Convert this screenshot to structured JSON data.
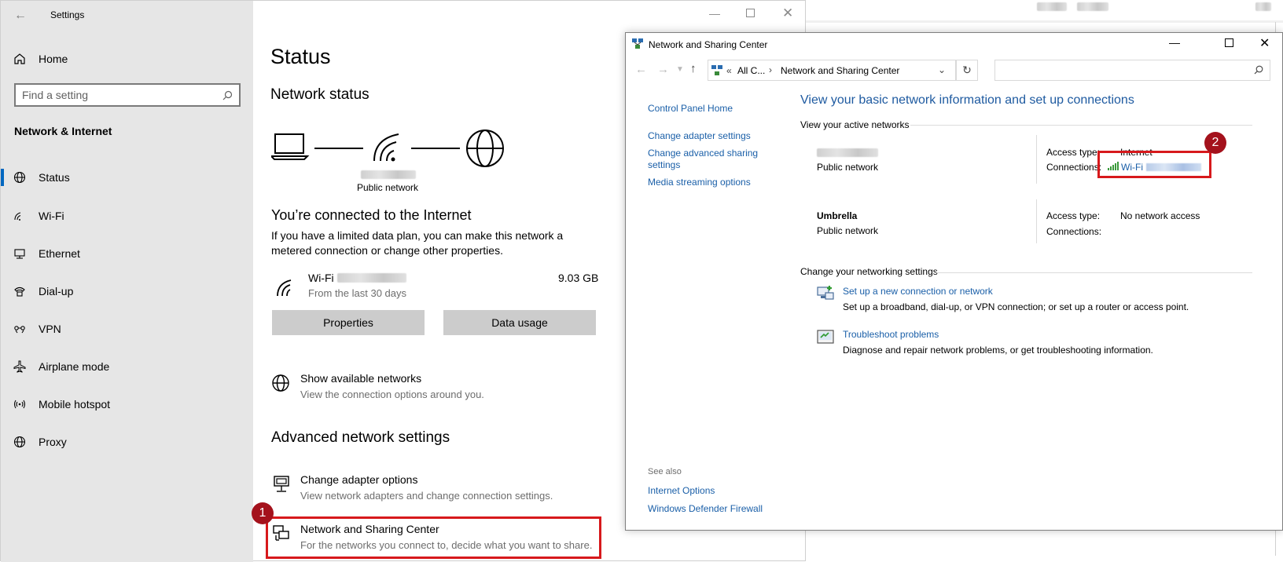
{
  "settings": {
    "window_title": "Settings",
    "sidebar": {
      "home_label": "Home",
      "search_placeholder": "Find a setting",
      "category": "Network & Internet",
      "items": [
        {
          "label": "Status",
          "icon": "globe-status-icon"
        },
        {
          "label": "Wi-Fi",
          "icon": "wifi-icon"
        },
        {
          "label": "Ethernet",
          "icon": "ethernet-icon"
        },
        {
          "label": "Dial-up",
          "icon": "dialup-icon"
        },
        {
          "label": "VPN",
          "icon": "vpn-icon"
        },
        {
          "label": "Airplane mode",
          "icon": "airplane-icon"
        },
        {
          "label": "Mobile hotspot",
          "icon": "hotspot-icon"
        },
        {
          "label": "Proxy",
          "icon": "proxy-icon"
        }
      ]
    },
    "main": {
      "page_title": "Status",
      "network_status_heading": "Network status",
      "diagram_label": "Public network",
      "connected_heading": "You’re connected to the Internet",
      "connected_desc": "If you have a limited data plan, you can make this network a metered connection or change other properties.",
      "connection": {
        "name": "Wi-Fi",
        "usage": "9.03 GB",
        "period": "From the last 30 days"
      },
      "properties_button": "Properties",
      "data_usage_button": "Data usage",
      "show_networks": {
        "title": "Show available networks",
        "desc": "View the connection options around you."
      },
      "advanced_heading": "Advanced network settings",
      "change_adapter": {
        "title": "Change adapter options",
        "desc": "View network adapters and change connection settings."
      },
      "sharing_center": {
        "title": "Network and Sharing Center",
        "desc": "For the networks you connect to, decide what you want to share."
      }
    }
  },
  "nsc": {
    "window_title": "Network and Sharing Center",
    "breadcrumb": {
      "root": "All C...",
      "current": "Network and Sharing Center"
    },
    "left_links": [
      "Control Panel Home",
      "Change adapter settings",
      "Change advanced sharing settings",
      "Media streaming options"
    ],
    "see_also": {
      "label": "See also",
      "links": [
        "Internet Options",
        "Windows Defender Firewall"
      ]
    },
    "heading": "View your basic network information and set up connections",
    "active_networks_label": "View your active networks",
    "networks": [
      {
        "name": "",
        "type": "Public network",
        "access_type_label": "Access type:",
        "access_type": "Internet",
        "connections_label": "Connections:",
        "connection": "Wi-Fi"
      },
      {
        "name": "Umbrella",
        "type": "Public network",
        "access_type_label": "Access type:",
        "access_type": "No network access",
        "connections_label": "Connections:",
        "connection": ""
      }
    ],
    "change_settings_label": "Change your networking settings",
    "actions": [
      {
        "title": "Set up a new connection or network",
        "desc": "Set up a broadband, dial-up, or VPN connection; or set up a router or access point."
      },
      {
        "title": "Troubleshoot problems",
        "desc": "Diagnose and repair network problems, or get troubleshooting information."
      }
    ]
  },
  "annotations": {
    "badge1": "1",
    "badge2": "2"
  },
  "colors": {
    "accent": "#0067c0",
    "link": "#1a5fa8",
    "highlight_red": "#d7191c",
    "badge_red": "#a4121c"
  }
}
